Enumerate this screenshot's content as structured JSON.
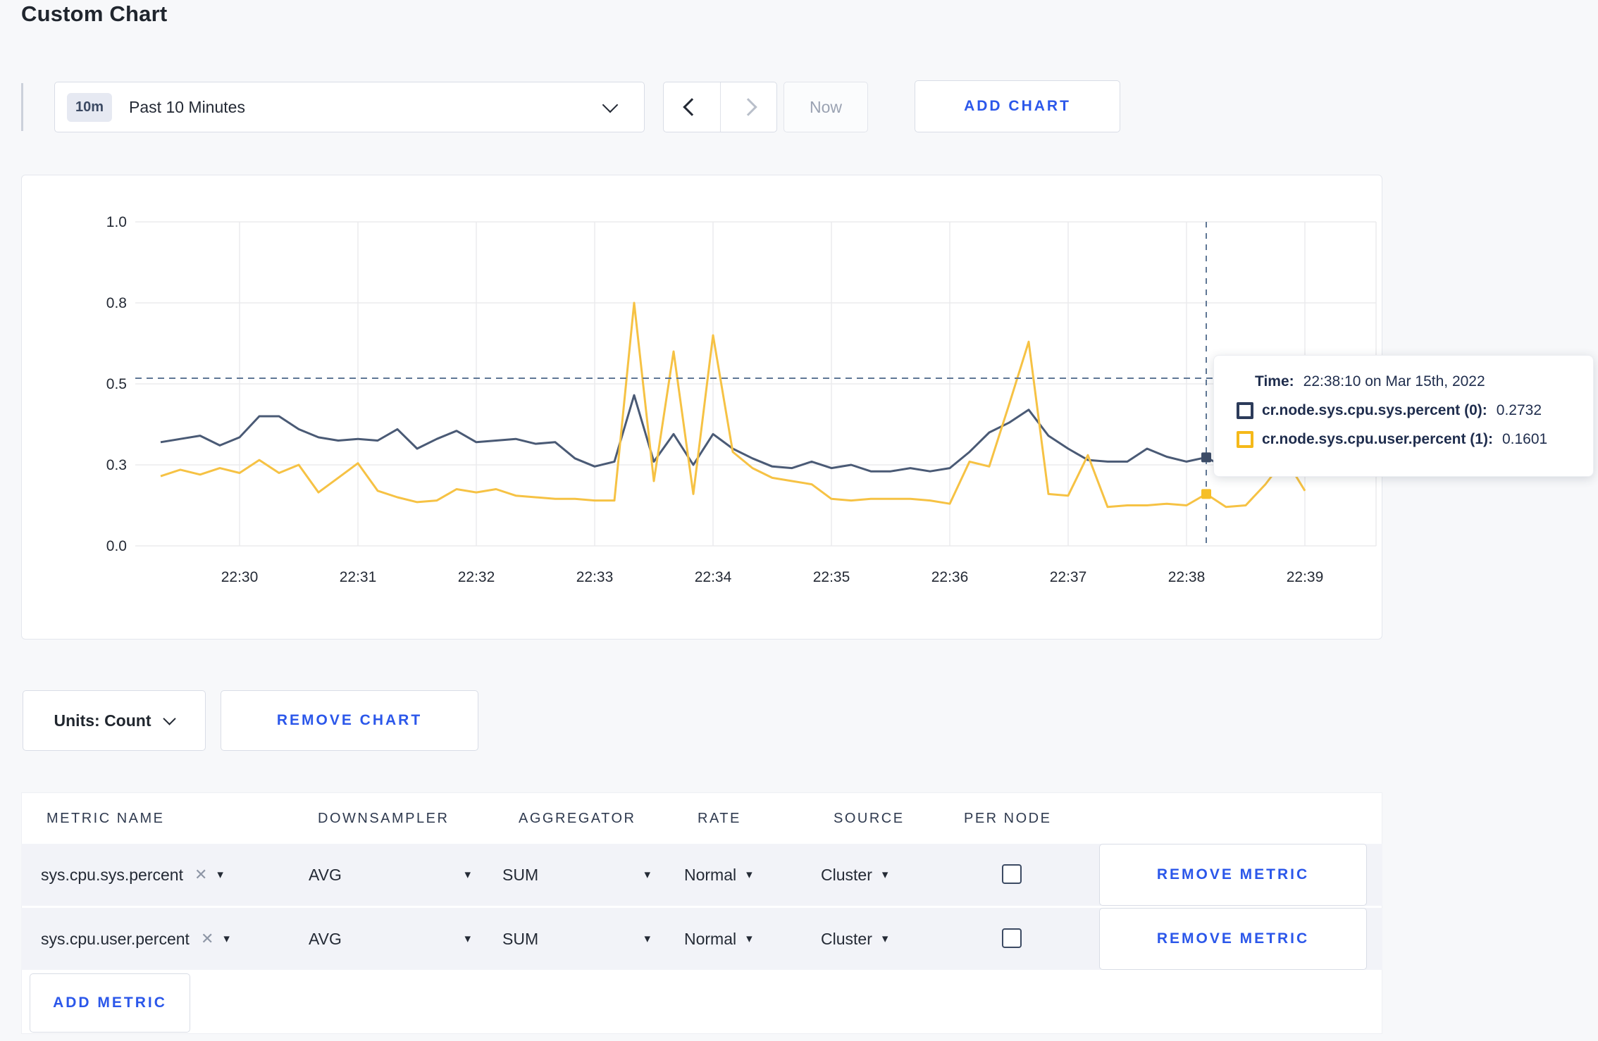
{
  "page": {
    "title": "Custom Chart"
  },
  "toolbar": {
    "range_badge": "10m",
    "range_label": "Past 10 Minutes",
    "now_label": "Now",
    "add_chart_label": "ADD CHART"
  },
  "chart_actions": {
    "units_label": "Units: Count",
    "remove_chart_label": "REMOVE CHART"
  },
  "tooltip": {
    "time_label": "Time:",
    "time_value": "22:38:10 on Mar 15th, 2022",
    "series": [
      {
        "label": "cr.node.sys.cpu.sys.percent (0):",
        "value": "0.2732",
        "color": "#2c3b5a"
      },
      {
        "label": "cr.node.sys.cpu.user.percent (1):",
        "value": "0.1601",
        "color": "#f5b919"
      }
    ]
  },
  "metric_table": {
    "headers": [
      "METRIC NAME",
      "DOWNSAMPLER",
      "AGGREGATOR",
      "RATE",
      "SOURCE",
      "PER NODE"
    ],
    "rows": [
      {
        "name": "sys.cpu.sys.percent",
        "downsampler": "AVG",
        "aggregator": "SUM",
        "rate": "Normal",
        "source": "Cluster",
        "per_node": false,
        "remove_label": "REMOVE METRIC"
      },
      {
        "name": "sys.cpu.user.percent",
        "downsampler": "AVG",
        "aggregator": "SUM",
        "rate": "Normal",
        "source": "Cluster",
        "per_node": false,
        "remove_label": "REMOVE METRIC"
      }
    ],
    "add_metric_label": "ADD METRIC"
  },
  "chart_data": {
    "type": "line",
    "note": "Linear y axis 0-1; gridlines every 0.25 labeled with rounded values (0.25->0.3, 0.75->0.8). x = seconds relative to 22:30:00.",
    "x_axis": {
      "ticks": [
        {
          "label": "22:30",
          "t": 0
        },
        {
          "label": "22:31",
          "t": 60
        },
        {
          "label": "22:32",
          "t": 120
        },
        {
          "label": "22:33",
          "t": 180
        },
        {
          "label": "22:34",
          "t": 240
        },
        {
          "label": "22:35",
          "t": 300
        },
        {
          "label": "22:36",
          "t": 360
        },
        {
          "label": "22:37",
          "t": 420
        },
        {
          "label": "22:38",
          "t": 480
        },
        {
          "label": "22:39",
          "t": 540
        }
      ]
    },
    "y_axis": {
      "ticks": [
        {
          "label": "1.0",
          "value": 1.0
        },
        {
          "label": "0.8",
          "value": 0.75
        },
        {
          "label": "0.5",
          "value": 0.5
        },
        {
          "label": "0.3",
          "value": 0.25
        },
        {
          "label": "0.0",
          "value": 0.0
        }
      ],
      "range": [
        0,
        1
      ]
    },
    "x_offsets_seconds": [
      -40,
      -30,
      -20,
      -10,
      0,
      10,
      20,
      30,
      40,
      50,
      60,
      70,
      80,
      90,
      100,
      110,
      120,
      130,
      140,
      150,
      160,
      170,
      180,
      190,
      200,
      210,
      220,
      230,
      240,
      250,
      260,
      270,
      280,
      290,
      300,
      310,
      320,
      330,
      340,
      350,
      360,
      370,
      380,
      390,
      400,
      410,
      420,
      430,
      440,
      450,
      460,
      470,
      480,
      490,
      500,
      510,
      520,
      530,
      540
    ],
    "series": [
      {
        "name": "cr.node.sys.cpu.sys.percent",
        "color": "#4a5a75",
        "values": [
          0.32,
          0.33,
          0.34,
          0.31,
          0.335,
          0.4,
          0.4,
          0.36,
          0.335,
          0.325,
          0.33,
          0.325,
          0.36,
          0.3,
          0.33,
          0.355,
          0.32,
          0.325,
          0.33,
          0.315,
          0.32,
          0.27,
          0.245,
          0.26,
          0.465,
          0.26,
          0.345,
          0.25,
          0.345,
          0.3,
          0.27,
          0.245,
          0.24,
          0.26,
          0.24,
          0.25,
          0.23,
          0.23,
          0.24,
          0.23,
          0.24,
          0.29,
          0.35,
          0.38,
          0.42,
          0.34,
          0.3,
          0.265,
          0.26,
          0.26,
          0.3,
          0.275,
          0.26,
          0.2732,
          0.24,
          0.25,
          0.26,
          0.255,
          0.26
        ]
      },
      {
        "name": "cr.node.sys.cpu.user.percent",
        "color": "#f6c244",
        "values": [
          0.215,
          0.235,
          0.22,
          0.24,
          0.225,
          0.265,
          0.225,
          0.25,
          0.165,
          0.21,
          0.255,
          0.17,
          0.15,
          0.135,
          0.14,
          0.175,
          0.165,
          0.175,
          0.155,
          0.15,
          0.145,
          0.145,
          0.14,
          0.14,
          0.75,
          0.2,
          0.6,
          0.16,
          0.65,
          0.29,
          0.24,
          0.21,
          0.2,
          0.19,
          0.145,
          0.14,
          0.145,
          0.145,
          0.145,
          0.14,
          0.13,
          0.26,
          0.245,
          0.435,
          0.63,
          0.16,
          0.155,
          0.28,
          0.12,
          0.125,
          0.125,
          0.13,
          0.125,
          0.1601,
          0.12,
          0.125,
          0.19,
          0.27,
          0.17
        ]
      }
    ],
    "crosshair": {
      "t": 490,
      "hline_value": 0.5175,
      "points": [
        {
          "series": 0,
          "value": 0.2732
        },
        {
          "series": 1,
          "value": 0.1601
        }
      ]
    },
    "grid": true,
    "legend_position": "tooltip"
  }
}
